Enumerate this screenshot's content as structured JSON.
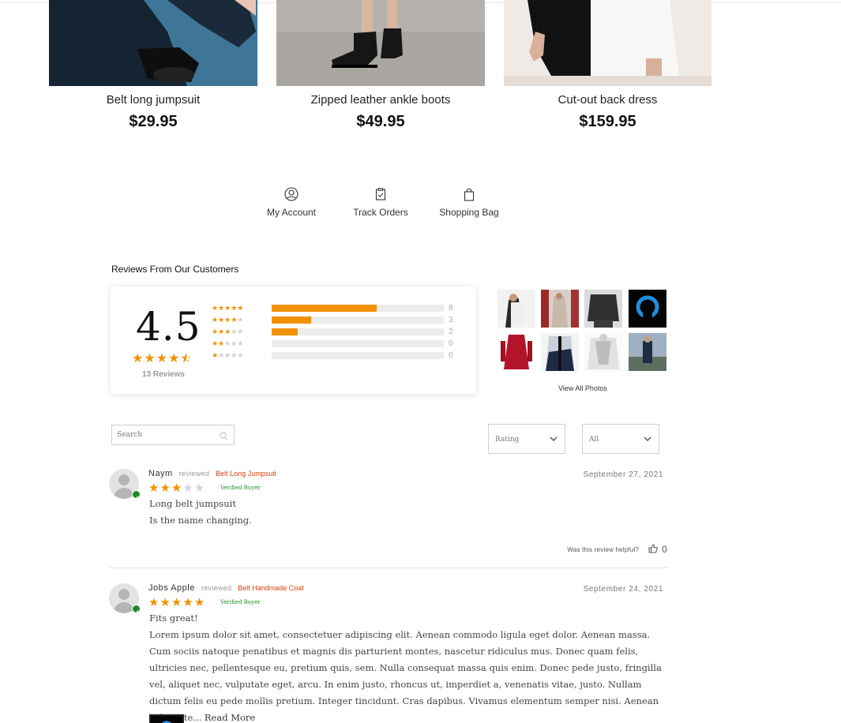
{
  "products": [
    {
      "name": "Belt long jumpsuit",
      "price": "$29.95"
    },
    {
      "name": "Zipped leather ankle boots",
      "price": "$49.95"
    },
    {
      "name": "Cut-out back dress",
      "price": "$159.95"
    }
  ],
  "quick_links": {
    "account": {
      "label": "My Account",
      "icon": "user-circle-icon"
    },
    "orders": {
      "label": "Track Orders",
      "icon": "clipboard-check-icon"
    },
    "bag": {
      "label": "Shopping Bag",
      "icon": "shopping-bag-icon"
    }
  },
  "reviews": {
    "title": "Reviews From Our Customers",
    "average": "4.5",
    "average_value": 4.5,
    "count_label": "13 Reviews",
    "distribution": [
      {
        "stars": 5,
        "count": "8",
        "fraction": 0.61
      },
      {
        "stars": 4,
        "count": "3",
        "fraction": 0.23
      },
      {
        "stars": 3,
        "count": "2",
        "fraction": 0.15
      },
      {
        "stars": 2,
        "count": "0",
        "fraction": 0
      },
      {
        "stars": 1,
        "count": "0",
        "fraction": 0
      }
    ],
    "view_all_photos": "View All Photos",
    "search_placeholder": "Search",
    "rating_filter": "Rating",
    "sort_filter": "All",
    "helpful_label": "Was this review helpful?",
    "items": [
      {
        "author": "Naym",
        "reviewed": "reviewed",
        "product": "Belt Long Jumpsuit",
        "rating": 3,
        "verified": "Verified Buyer",
        "date": "September 27, 2021",
        "title": "Long belt jumpsuit",
        "text": "Is the name changing.",
        "helpful_count": "0"
      },
      {
        "author": "Jobs Apple",
        "reviewed": "reviewed",
        "product": "Belt Handmade Coat",
        "rating": 5,
        "verified": "Verified Buyer",
        "date": "September 24, 2021",
        "title": "Fits great!",
        "text": "Lorem ipsum dolor sit amet, consectetuer adipiscing elit. Aenean commodo ligula eget dolor. Aenean massa. Cum sociis natoque penatibus et magnis dis parturient montes, nascetur ridiculus mus. Donec quam felis, ultricies nec, pellentesque eu, pretium quis, sem. Nulla consequat massa quis enim. Donec pede justo, fringilla vel, aliquet nec, vulputate eget, arcu. In enim justo, rhoncus ut, imperdiet a, venenatis vitae, justo. Nullam dictum felis eu pede mollis pretium. Integer tincidunt. Cras dapibus. Vivamus elementum semper nisi. Aenean vulputate...",
        "read_more": "Read More"
      }
    ]
  },
  "colors": {
    "accent": "#f29100",
    "verified": "#1f8b24",
    "product_link": "#d9400a"
  }
}
